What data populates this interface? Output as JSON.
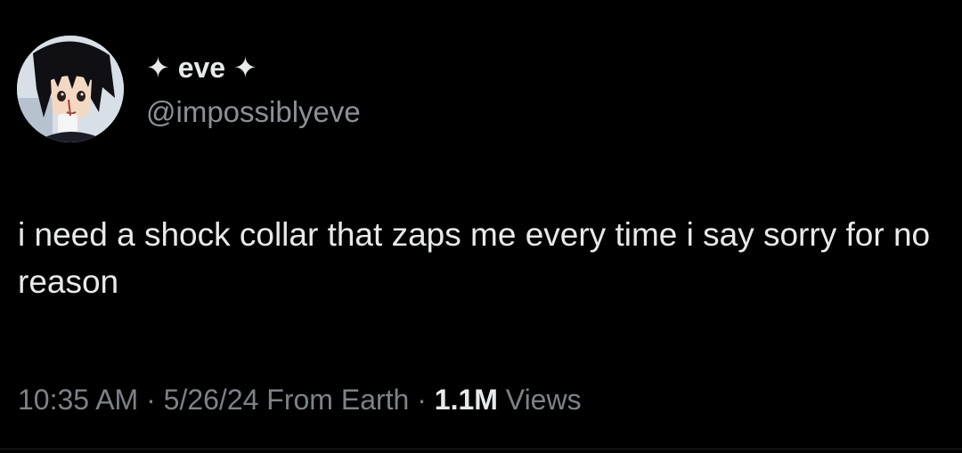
{
  "author": {
    "display_name": "✦ eve ✦",
    "handle": "@impossiblyeve",
    "avatar_icon": "anime-character-avatar"
  },
  "tweet": {
    "text": "i need a shock collar that zaps me every time i say sorry for no reason"
  },
  "meta": {
    "time": "10:35 AM",
    "separator": " · ",
    "date": "5/26/24",
    "source": "From Earth",
    "views_count": "1.1M",
    "views_label": "Views"
  },
  "colors": {
    "background": "#000000",
    "primary_text": "#e7e9ea",
    "secondary_text": "#7d8287"
  }
}
